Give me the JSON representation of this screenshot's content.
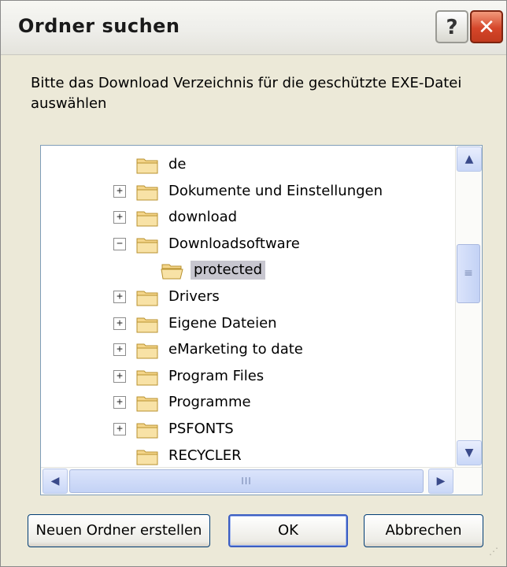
{
  "window": {
    "title": "Ordner suchen"
  },
  "titlebar": {
    "help_label": "?",
    "close_label": "✕"
  },
  "prompt": "Bitte das Download Verzeichnis für die geschützte EXE-Datei auswählen",
  "tree": {
    "items": [
      {
        "label": "de",
        "expander": "",
        "indent": 0
      },
      {
        "label": "Dokumente und Einstellungen",
        "expander": "+",
        "indent": 0
      },
      {
        "label": "download",
        "expander": "+",
        "indent": 0
      },
      {
        "label": "Downloadsoftware",
        "expander": "−",
        "indent": 0
      },
      {
        "label": "protected",
        "expander": "",
        "indent": 1,
        "selected": true,
        "open": true
      },
      {
        "label": "Drivers",
        "expander": "+",
        "indent": 0
      },
      {
        "label": "Eigene Dateien",
        "expander": "+",
        "indent": 0
      },
      {
        "label": "eMarketing to date",
        "expander": "+",
        "indent": 0
      },
      {
        "label": "Program Files",
        "expander": "+",
        "indent": 0
      },
      {
        "label": "Programme",
        "expander": "+",
        "indent": 0
      },
      {
        "label": "PSFONTS",
        "expander": "+",
        "indent": 0
      },
      {
        "label": "RECYCLER",
        "expander": "",
        "indent": 0
      }
    ]
  },
  "scrollbars": {
    "up": "▲",
    "down": "▼",
    "left": "◀",
    "right": "▶",
    "thumb_grip": "≡",
    "hthumb_grip": "III"
  },
  "buttons": {
    "new_folder": "Neuen Ordner erstellen",
    "ok": "OK",
    "cancel": "Abbrechen"
  },
  "colors": {
    "selection": "#c7c6cf",
    "folder": "#f4d58a",
    "close": "#d5462a",
    "window_bg": "#ece9d8"
  }
}
